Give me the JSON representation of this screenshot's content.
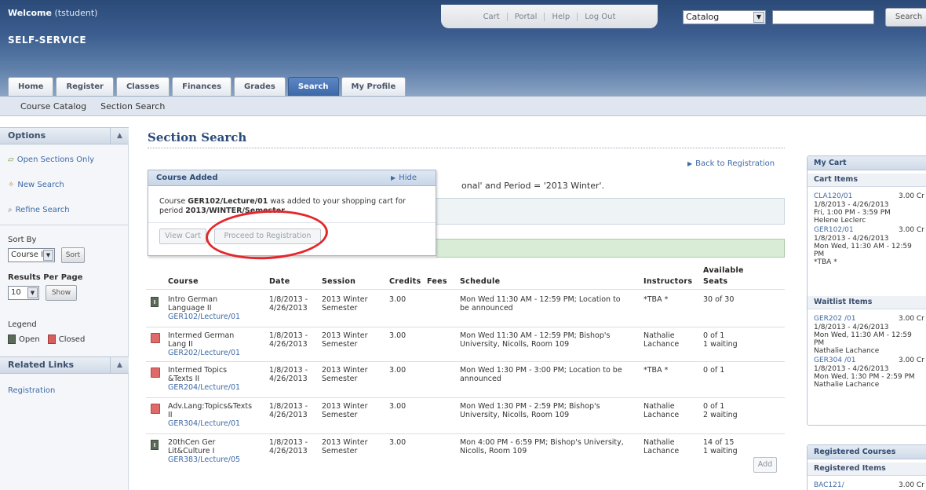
{
  "header": {
    "welcome_label": "Welcome",
    "welcome_user": "(tstudent)",
    "app_title": "SELF-SERVICE",
    "links": [
      "Cart",
      "Portal",
      "Help",
      "Log Out"
    ],
    "search_scope": "Catalog",
    "search_value": "",
    "search_button": "Search"
  },
  "tabs": [
    "Home",
    "Register",
    "Classes",
    "Finances",
    "Grades",
    "Search",
    "My Profile"
  ],
  "active_tab": "Search",
  "subnav": [
    "Course Catalog",
    "Section Search"
  ],
  "sidebar": {
    "options_title": "Options",
    "links": [
      "Open Sections Only",
      "New Search",
      "Refine Search"
    ],
    "sort_by_label": "Sort By",
    "sort_value": "Course ID",
    "sort_button": "Sort",
    "results_label": "Results Per Page",
    "results_value": "10",
    "show_button": "Show",
    "legend_label": "Legend",
    "legend_open": "Open",
    "legend_closed": "Closed",
    "related_title": "Related Links",
    "related_links": [
      "Registration"
    ]
  },
  "main": {
    "title": "Section Search",
    "back_link": "Back to Registration",
    "criteria_fragment": "onal' and Period = '2013 Winter'."
  },
  "popup": {
    "title": "Course Added",
    "hide_label": "Hide",
    "msg_pre": "Course ",
    "msg_course": "GER102/Lecture/01",
    "msg_mid": " was added to your shopping cart for period ",
    "msg_period": "2013/WINTER/Semester",
    "msg_end": ".",
    "view_cart": "View Cart",
    "proceed": "Proceed to Registration"
  },
  "table": {
    "headers": {
      "course": "Course",
      "date": "Date",
      "session": "Session",
      "credits": "Credits",
      "fees": "Fees",
      "schedule": "Schedule",
      "instructors": "Instructors",
      "available_1": "Available",
      "available_2": "Seats"
    },
    "rows": [
      {
        "status": "open",
        "name1": "Intro German",
        "name2": "Language II",
        "code": "GER102/Lecture/01",
        "date1": "1/8/2013 -",
        "date2": "4/26/2013",
        "session1": "2013 Winter",
        "session2": "Semester",
        "credits": "3.00",
        "sched1": "Mon Wed 11:30 AM - 12:59 PM; Location to",
        "sched2": "be announced",
        "instr1": "*TBA *",
        "instr2": "",
        "seats1": "30 of 30",
        "seats2": ""
      },
      {
        "status": "closed",
        "name1": "Intermed German",
        "name2": "Lang II",
        "code": "GER202/Lecture/01",
        "date1": "1/8/2013 -",
        "date2": "4/26/2013",
        "session1": "2013 Winter",
        "session2": "Semester",
        "credits": "3.00",
        "sched1": "Mon Wed 11:30 AM - 12:59 PM; Bishop's",
        "sched2": "University, Nicolls, Room 109",
        "instr1": "Nathalie",
        "instr2": "Lachance",
        "seats1": "0 of 1",
        "seats2": "1 waiting"
      },
      {
        "status": "closed",
        "name1": "Intermed Topics",
        "name2": "&Texts II",
        "code": "GER204/Lecture/01",
        "date1": "1/8/2013 -",
        "date2": "4/26/2013",
        "session1": "2013 Winter",
        "session2": "Semester",
        "credits": "3.00",
        "sched1": "Mon Wed 1:30 PM - 3:00 PM; Location to be",
        "sched2": "announced",
        "instr1": "*TBA *",
        "instr2": "",
        "seats1": "0 of 1",
        "seats2": ""
      },
      {
        "status": "closed",
        "name1": "Adv.Lang:Topics&Texts",
        "name2": "II",
        "code": "GER304/Lecture/01",
        "date1": "1/8/2013 -",
        "date2": "4/26/2013",
        "session1": "2013 Winter",
        "session2": "Semester",
        "credits": "3.00",
        "sched1": "Mon Wed 1:30 PM - 2:59 PM; Bishop's",
        "sched2": "University, Nicolls, Room 109",
        "instr1": "Nathalie",
        "instr2": "Lachance",
        "seats1": "0 of 1",
        "seats2": "2 waiting"
      },
      {
        "status": "open",
        "name1": "20thCen Ger",
        "name2": "Lit&Culture I",
        "code": "GER383/Lecture/05",
        "date1": "1/8/2013 -",
        "date2": "4/26/2013",
        "session1": "2013 Winter",
        "session2": "Semester",
        "credits": "3.00",
        "sched1": "Mon 4:00 PM - 6:59 PM; Bishop's University,",
        "sched2": "Nicolls, Room 109",
        "instr1": "Nathalie",
        "instr2": "Lachance",
        "seats1": "14 of 15",
        "seats2": "1 waiting"
      }
    ],
    "add_button": "Add"
  },
  "cart": {
    "title": "My Cart",
    "cart_items_label": "Cart Items",
    "cart_items": [
      {
        "code": "CLA120/01",
        "credits": "3.00 Cr",
        "lines": [
          "1/8/2013 - 4/26/2013",
          "Fri, 1:00 PM - 3:59 PM",
          "Helene Leclerc"
        ]
      },
      {
        "code": "GER102/01",
        "credits": "3.00 Cr",
        "lines": [
          "1/8/2013 - 4/26/2013",
          "Mon Wed, 11:30 AM - 12:59",
          "PM",
          "*TBA *"
        ]
      }
    ],
    "waitlist_label": "Waitlist Items",
    "waitlist_items": [
      {
        "code": "GER202 /01",
        "credits": "3.00 Cr",
        "lines": [
          "1/8/2013 - 4/26/2013",
          "Mon Wed, 11:30 AM - 12:59",
          "PM",
          "Nathalie Lachance"
        ]
      },
      {
        "code": "GER304 /01",
        "credits": "3.00 Cr",
        "lines": [
          "1/8/2013 - 4/26/2013",
          "Mon Wed, 1:30 PM - 2:59 PM",
          "Nathalie Lachance"
        ]
      }
    ]
  },
  "registered": {
    "title": "Registered Courses",
    "items_label": "Registered Items",
    "items": [
      {
        "code": "BAC121/",
        "credits": "3.00 Cr"
      }
    ]
  }
}
